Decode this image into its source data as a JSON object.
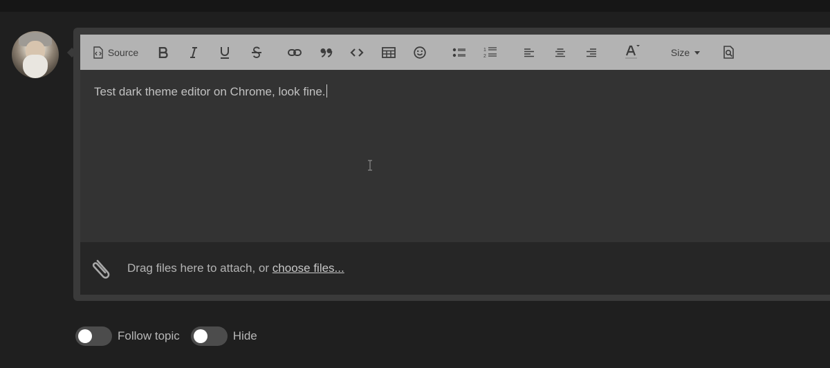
{
  "toolbar": {
    "source_label": "Source",
    "size_label": "Size",
    "buttons": [
      "source-icon",
      "bold-icon",
      "italic-icon",
      "underline-icon",
      "strikethrough-icon",
      "link-icon",
      "quote-icon",
      "code-icon",
      "table-icon",
      "smiley-icon",
      "bullet-list-icon",
      "numbered-list-icon",
      "align-left-icon",
      "align-center-icon",
      "align-right-icon",
      "text-color-icon",
      "chevron-down-icon",
      "preview-icon"
    ]
  },
  "editor": {
    "content": "Test dark theme editor on Chrome, look fine."
  },
  "attachments": {
    "prompt": "Drag files here to attach, or ",
    "link_text": "choose files..."
  },
  "options": {
    "follow_label": "Follow topic",
    "hide_label": "Hide"
  },
  "colors": {
    "background": "#1f1f1f",
    "toolbar": "#b3b3b3",
    "editor": "#333333",
    "attach_bar": "#262626"
  }
}
